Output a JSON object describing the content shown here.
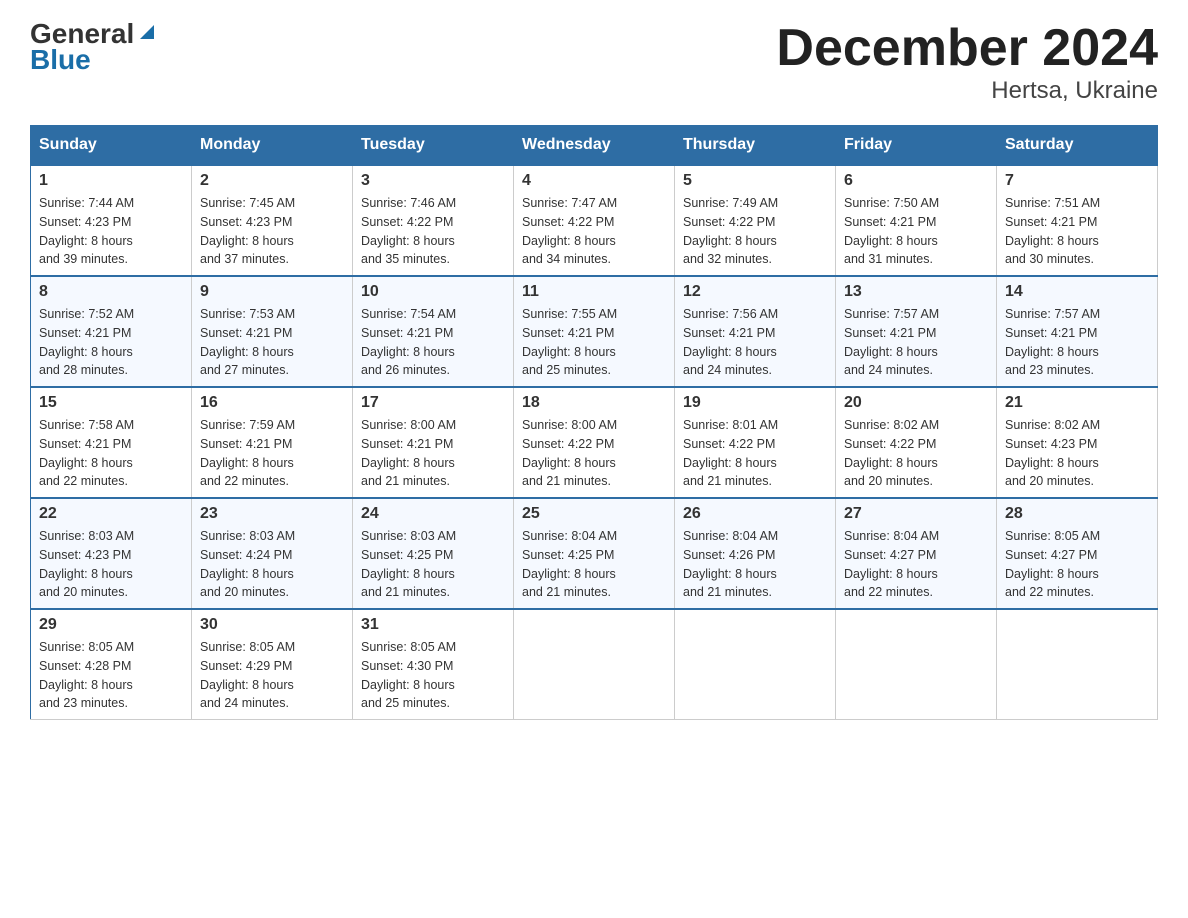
{
  "logo": {
    "part1": "General",
    "part2": "Blue"
  },
  "title": "December 2024",
  "subtitle": "Hertsa, Ukraine",
  "days_of_week": [
    "Sunday",
    "Monday",
    "Tuesday",
    "Wednesday",
    "Thursday",
    "Friday",
    "Saturday"
  ],
  "weeks": [
    [
      {
        "day": "1",
        "sunrise": "7:44 AM",
        "sunset": "4:23 PM",
        "daylight": "8 hours and 39 minutes."
      },
      {
        "day": "2",
        "sunrise": "7:45 AM",
        "sunset": "4:23 PM",
        "daylight": "8 hours and 37 minutes."
      },
      {
        "day": "3",
        "sunrise": "7:46 AM",
        "sunset": "4:22 PM",
        "daylight": "8 hours and 35 minutes."
      },
      {
        "day": "4",
        "sunrise": "7:47 AM",
        "sunset": "4:22 PM",
        "daylight": "8 hours and 34 minutes."
      },
      {
        "day": "5",
        "sunrise": "7:49 AM",
        "sunset": "4:22 PM",
        "daylight": "8 hours and 32 minutes."
      },
      {
        "day": "6",
        "sunrise": "7:50 AM",
        "sunset": "4:21 PM",
        "daylight": "8 hours and 31 minutes."
      },
      {
        "day": "7",
        "sunrise": "7:51 AM",
        "sunset": "4:21 PM",
        "daylight": "8 hours and 30 minutes."
      }
    ],
    [
      {
        "day": "8",
        "sunrise": "7:52 AM",
        "sunset": "4:21 PM",
        "daylight": "8 hours and 28 minutes."
      },
      {
        "day": "9",
        "sunrise": "7:53 AM",
        "sunset": "4:21 PM",
        "daylight": "8 hours and 27 minutes."
      },
      {
        "day": "10",
        "sunrise": "7:54 AM",
        "sunset": "4:21 PM",
        "daylight": "8 hours and 26 minutes."
      },
      {
        "day": "11",
        "sunrise": "7:55 AM",
        "sunset": "4:21 PM",
        "daylight": "8 hours and 25 minutes."
      },
      {
        "day": "12",
        "sunrise": "7:56 AM",
        "sunset": "4:21 PM",
        "daylight": "8 hours and 24 minutes."
      },
      {
        "day": "13",
        "sunrise": "7:57 AM",
        "sunset": "4:21 PM",
        "daylight": "8 hours and 24 minutes."
      },
      {
        "day": "14",
        "sunrise": "7:57 AM",
        "sunset": "4:21 PM",
        "daylight": "8 hours and 23 minutes."
      }
    ],
    [
      {
        "day": "15",
        "sunrise": "7:58 AM",
        "sunset": "4:21 PM",
        "daylight": "8 hours and 22 minutes."
      },
      {
        "day": "16",
        "sunrise": "7:59 AM",
        "sunset": "4:21 PM",
        "daylight": "8 hours and 22 minutes."
      },
      {
        "day": "17",
        "sunrise": "8:00 AM",
        "sunset": "4:21 PM",
        "daylight": "8 hours and 21 minutes."
      },
      {
        "day": "18",
        "sunrise": "8:00 AM",
        "sunset": "4:22 PM",
        "daylight": "8 hours and 21 minutes."
      },
      {
        "day": "19",
        "sunrise": "8:01 AM",
        "sunset": "4:22 PM",
        "daylight": "8 hours and 21 minutes."
      },
      {
        "day": "20",
        "sunrise": "8:02 AM",
        "sunset": "4:22 PM",
        "daylight": "8 hours and 20 minutes."
      },
      {
        "day": "21",
        "sunrise": "8:02 AM",
        "sunset": "4:23 PM",
        "daylight": "8 hours and 20 minutes."
      }
    ],
    [
      {
        "day": "22",
        "sunrise": "8:03 AM",
        "sunset": "4:23 PM",
        "daylight": "8 hours and 20 minutes."
      },
      {
        "day": "23",
        "sunrise": "8:03 AM",
        "sunset": "4:24 PM",
        "daylight": "8 hours and 20 minutes."
      },
      {
        "day": "24",
        "sunrise": "8:03 AM",
        "sunset": "4:25 PM",
        "daylight": "8 hours and 21 minutes."
      },
      {
        "day": "25",
        "sunrise": "8:04 AM",
        "sunset": "4:25 PM",
        "daylight": "8 hours and 21 minutes."
      },
      {
        "day": "26",
        "sunrise": "8:04 AM",
        "sunset": "4:26 PM",
        "daylight": "8 hours and 21 minutes."
      },
      {
        "day": "27",
        "sunrise": "8:04 AM",
        "sunset": "4:27 PM",
        "daylight": "8 hours and 22 minutes."
      },
      {
        "day": "28",
        "sunrise": "8:05 AM",
        "sunset": "4:27 PM",
        "daylight": "8 hours and 22 minutes."
      }
    ],
    [
      {
        "day": "29",
        "sunrise": "8:05 AM",
        "sunset": "4:28 PM",
        "daylight": "8 hours and 23 minutes."
      },
      {
        "day": "30",
        "sunrise": "8:05 AM",
        "sunset": "4:29 PM",
        "daylight": "8 hours and 24 minutes."
      },
      {
        "day": "31",
        "sunrise": "8:05 AM",
        "sunset": "4:30 PM",
        "daylight": "8 hours and 25 minutes."
      },
      null,
      null,
      null,
      null
    ]
  ],
  "labels": {
    "sunrise": "Sunrise:",
    "sunset": "Sunset:",
    "daylight": "Daylight:"
  }
}
